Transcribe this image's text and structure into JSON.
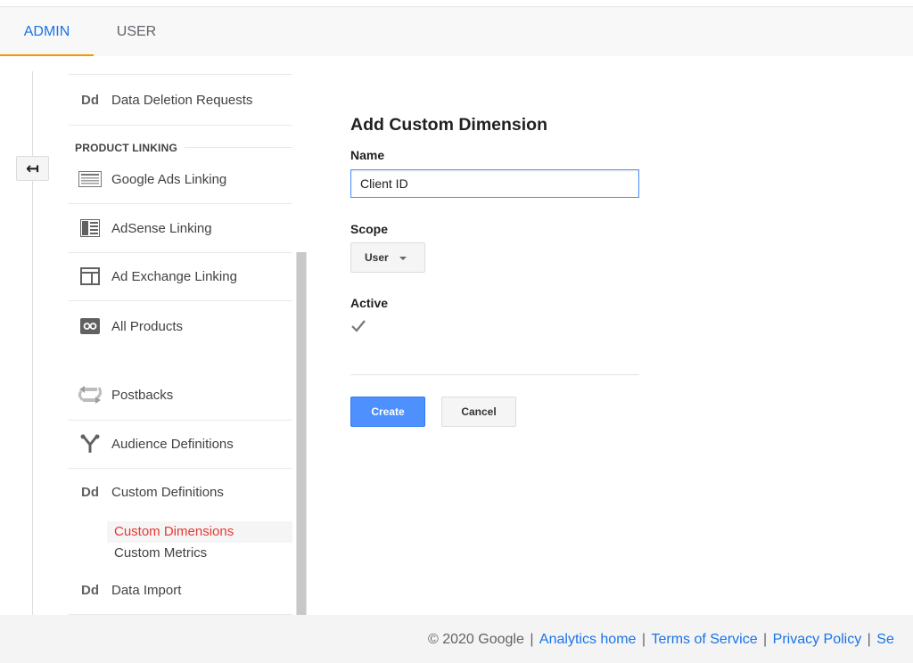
{
  "tabs": {
    "admin": "ADMIN",
    "user": "USER"
  },
  "nav": {
    "data_deletion": "Data Deletion Requests",
    "section_product_linking": "PRODUCT LINKING",
    "google_ads": "Google Ads Linking",
    "adsense": "AdSense Linking",
    "ad_exchange": "Ad Exchange Linking",
    "all_products": "All Products",
    "postbacks": "Postbacks",
    "audience_definitions": "Audience Definitions",
    "custom_definitions": "Custom Definitions",
    "custom_dimensions": "Custom Dimensions",
    "custom_metrics": "Custom Metrics",
    "data_import": "Data Import",
    "dd_badge": "Dd"
  },
  "form": {
    "title": "Add Custom Dimension",
    "name_label": "Name",
    "name_value": "Client ID",
    "scope_label": "Scope",
    "scope_value": "User",
    "active_label": "Active",
    "active_checked": true,
    "create_label": "Create",
    "cancel_label": "Cancel"
  },
  "footer": {
    "copyright": "© 2020 Google",
    "links": [
      "Analytics home",
      "Terms of Service",
      "Privacy Policy",
      "Se"
    ]
  },
  "colors": {
    "accent_blue": "#1a73e8",
    "tab_underline": "#f29900",
    "active_sub": "#e53935",
    "create_btn": "#4d90fe"
  }
}
